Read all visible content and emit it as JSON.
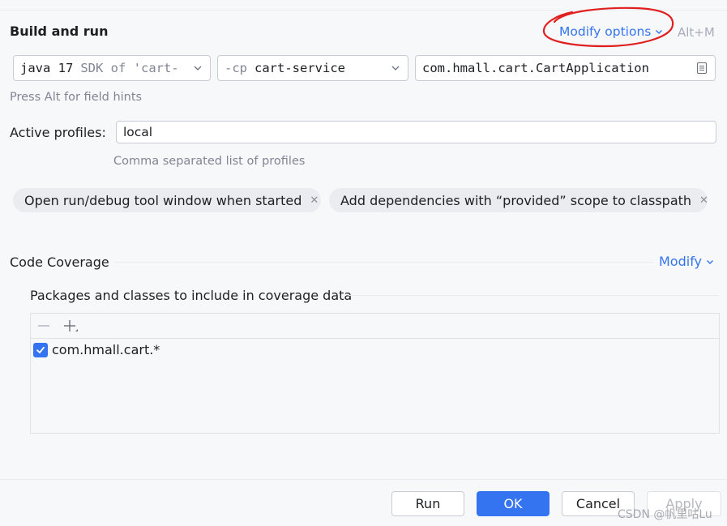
{
  "header": {
    "title": "Build and run",
    "modify_options": "Modify options",
    "modify_shortcut": "Alt+M",
    "annotation_color": "#e02020"
  },
  "run_config": {
    "jdk_prefix": "java 17",
    "jdk_suffix": "SDK of 'cart-",
    "cp_prefix": "-cp",
    "cp_module": "cart-service",
    "main_class": "com.hmall.cart.CartApplication",
    "field_hint": "Press Alt for field hints"
  },
  "profiles": {
    "label": "Active profiles:",
    "value": "local",
    "hint": "Comma separated list of profiles"
  },
  "chips": [
    {
      "label": "Open run/debug tool window when started"
    },
    {
      "label": "Add dependencies with “provided” scope to classpath"
    }
  ],
  "coverage": {
    "title": "Code Coverage",
    "modify": "Modify",
    "packages_title": "Packages and classes to include in coverage data",
    "packages": [
      {
        "pattern": "com.hmall.cart.*",
        "checked": true
      }
    ]
  },
  "buttons": {
    "run": "Run",
    "ok": "OK",
    "cancel": "Cancel",
    "apply": "Apply"
  },
  "watermark": "CSDN @帆里咕Lu",
  "colors": {
    "accent": "#3574f0",
    "background": "#f7f8fa",
    "muted_text": "#818594"
  }
}
